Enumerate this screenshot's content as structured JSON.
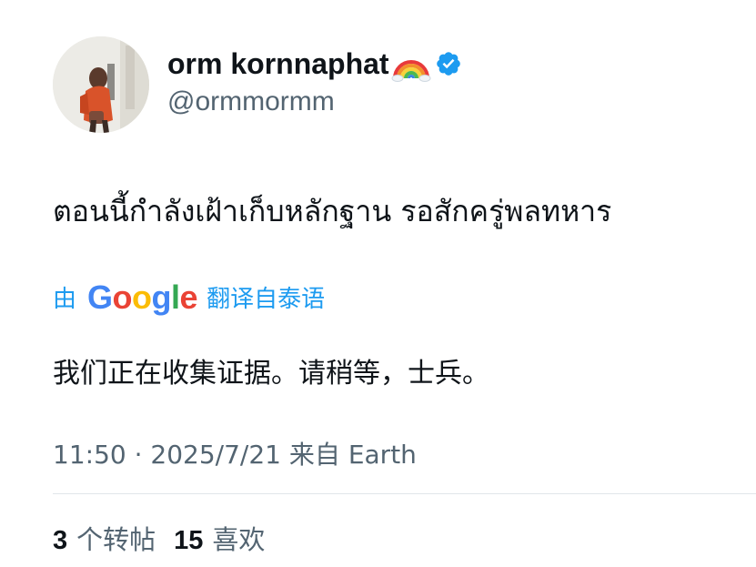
{
  "user": {
    "display_name": "orm kornnaphat",
    "handle": "@ormmormm"
  },
  "icons": {
    "avatar": "profile-photo",
    "rainbow": "rainbow-emoji-icon",
    "verified": "verified-badge-icon"
  },
  "tweet": {
    "text": "ตอนนี้กำลังเฝ้าเก็บหลักฐาน รอสักครู่พลทหาร"
  },
  "translation": {
    "prefix": "由",
    "provider": "Google",
    "suffix": "翻译自泰语",
    "text": "我们正在收集证据。请稍等，士兵。"
  },
  "meta": {
    "time": "11:50",
    "separator": "·",
    "date": "2025/7/21",
    "from_label": "来自",
    "location": "Earth"
  },
  "stats": {
    "retweets_count": "3",
    "retweets_label": "个转帖",
    "likes_count": "15",
    "likes_label": "喜欢"
  },
  "colors": {
    "accent": "#1d9bf0",
    "secondary_text": "#536471",
    "primary_text": "#0f1419"
  }
}
